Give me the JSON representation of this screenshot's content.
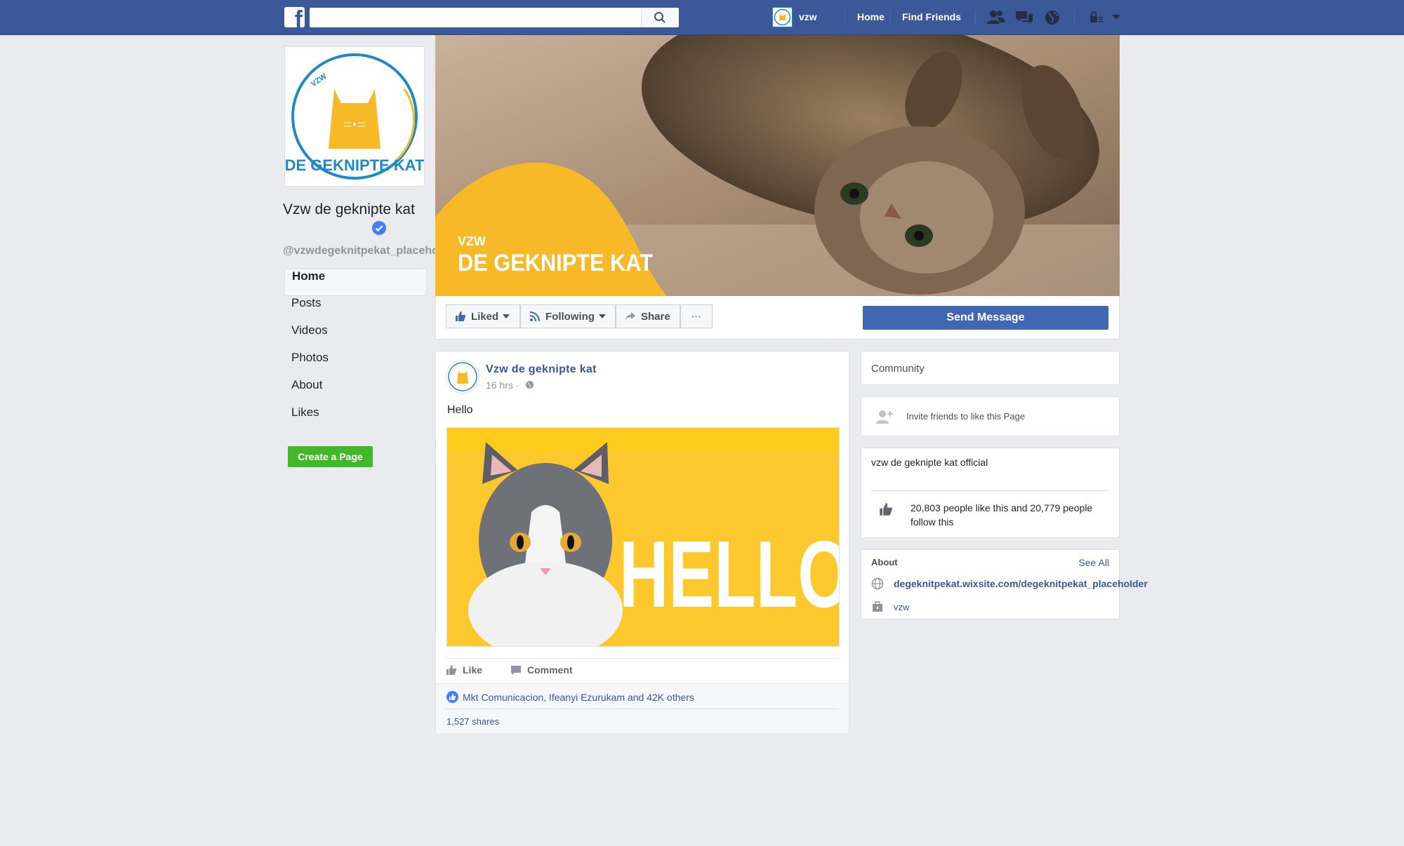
{
  "topbar": {
    "logo_letter": "f",
    "search_placeholder": "",
    "user_name": "vzw",
    "nav": [
      "Home",
      "Find Friends"
    ],
    "icons": [
      "friend-requests-icon",
      "messages-icon",
      "notifications-globe-icon",
      "privacy-lock-icon",
      "dropdown-arrow-icon"
    ]
  },
  "page": {
    "name": "Vzw de geknipte kat",
    "handle": "@vzwdegeknitpekat_placeholder",
    "logo_ring_text": "DE GEKNIPTE KAT",
    "logo_small_text": "VZW"
  },
  "leftnav": {
    "items": [
      {
        "label": "Home",
        "active": true
      },
      {
        "label": "Posts",
        "active": false
      },
      {
        "label": "Videos",
        "active": false
      },
      {
        "label": "Photos",
        "active": false
      },
      {
        "label": "About",
        "active": false
      },
      {
        "label": "Likes",
        "active": false
      }
    ],
    "create_page": "Create a Page"
  },
  "cover": {
    "small_text": "VZW",
    "big_text": "DE GEKNIPTE KAT"
  },
  "actions": {
    "liked": "Liked",
    "following": "Following",
    "share": "Share",
    "more": "···",
    "send_message": "Send Message"
  },
  "post": {
    "author": "Vzw de geknipte kat",
    "time": "16 hrs ·",
    "text": "Hello",
    "image_text": "HELLO",
    "like_label": "Like",
    "comment_label": "Comment",
    "likes_summary": "Mkt Comunicacion, Ifeanyi Ezurukam and 42K others",
    "shares": "1,527 shares"
  },
  "sidebar": {
    "community_title": "Community",
    "invite_text": "Invite friends to like this Page",
    "official_name": "vzw de geknipte kat official",
    "likes_follow": "20,803 people like this and 20,779 people follow this",
    "about_title": "About",
    "see_all": "See All",
    "website": "degeknitpekat.wixsite.com/degeknitpekat_placeholder",
    "category": "vzw"
  },
  "colors": {
    "fb_blue": "#3b5998",
    "brand_yellow": "#f7b928",
    "logo_blue": "#1e88c8",
    "create_green": "#42b72a"
  }
}
